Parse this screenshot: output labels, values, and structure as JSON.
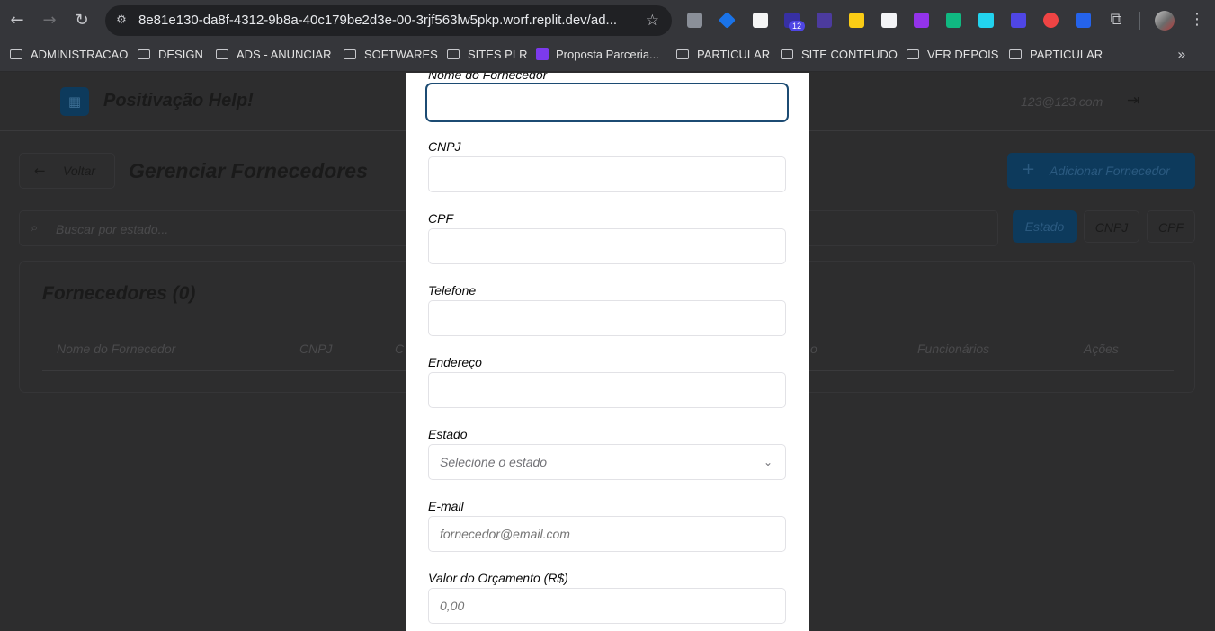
{
  "browser": {
    "url": "8e81e130-da8f-4312-9b8a-40c179be2d3e-00-3rjf563lw5pkp.worf.replit.dev/ad...",
    "extension_badge": "12",
    "bookmarks": [
      "ADMINISTRACAO",
      "DESIGN",
      "ADS - ANUNCIAR",
      "SOFTWARES",
      "SITES PLR",
      "Proposta Parceria...",
      "PARTICULAR",
      "SITE CONTEUDO",
      "VER DEPOIS",
      "PARTICULAR"
    ]
  },
  "app": {
    "title": "Positivação Help!",
    "user_email": "123@123.com",
    "back_label": "Voltar",
    "page_title": "Gerenciar Fornecedores",
    "add_button_label": "Adicionar Fornecedor",
    "search_placeholder": "Buscar por estado...",
    "filters": [
      "Estado",
      "CNPJ",
      "CPF"
    ],
    "active_filter": "Estado",
    "list_title": "Fornecedores (0)",
    "table_headers": [
      "Nome do Fornecedor",
      "CNPJ",
      "C",
      "o",
      "Funcionários",
      "Ações"
    ]
  },
  "modal": {
    "fields": [
      {
        "label": "Nome do Fornecedor",
        "value": "",
        "placeholder": ""
      },
      {
        "label": "CNPJ",
        "value": "",
        "placeholder": ""
      },
      {
        "label": "CPF",
        "value": "",
        "placeholder": ""
      },
      {
        "label": "Telefone",
        "value": "",
        "placeholder": ""
      },
      {
        "label": "Endereço",
        "value": "",
        "placeholder": ""
      },
      {
        "label": "Estado",
        "value": "",
        "placeholder": "Selecione o estado"
      },
      {
        "label": "E-mail",
        "value": "",
        "placeholder": "fornecedor@email.com"
      },
      {
        "label": "Valor do Orçamento (R$)",
        "value": "",
        "placeholder": "0,00"
      }
    ]
  },
  "colors": {
    "primary": "#1c4b73",
    "overlay_background": "#2d2d2e",
    "modal_background": "#ffffff"
  }
}
